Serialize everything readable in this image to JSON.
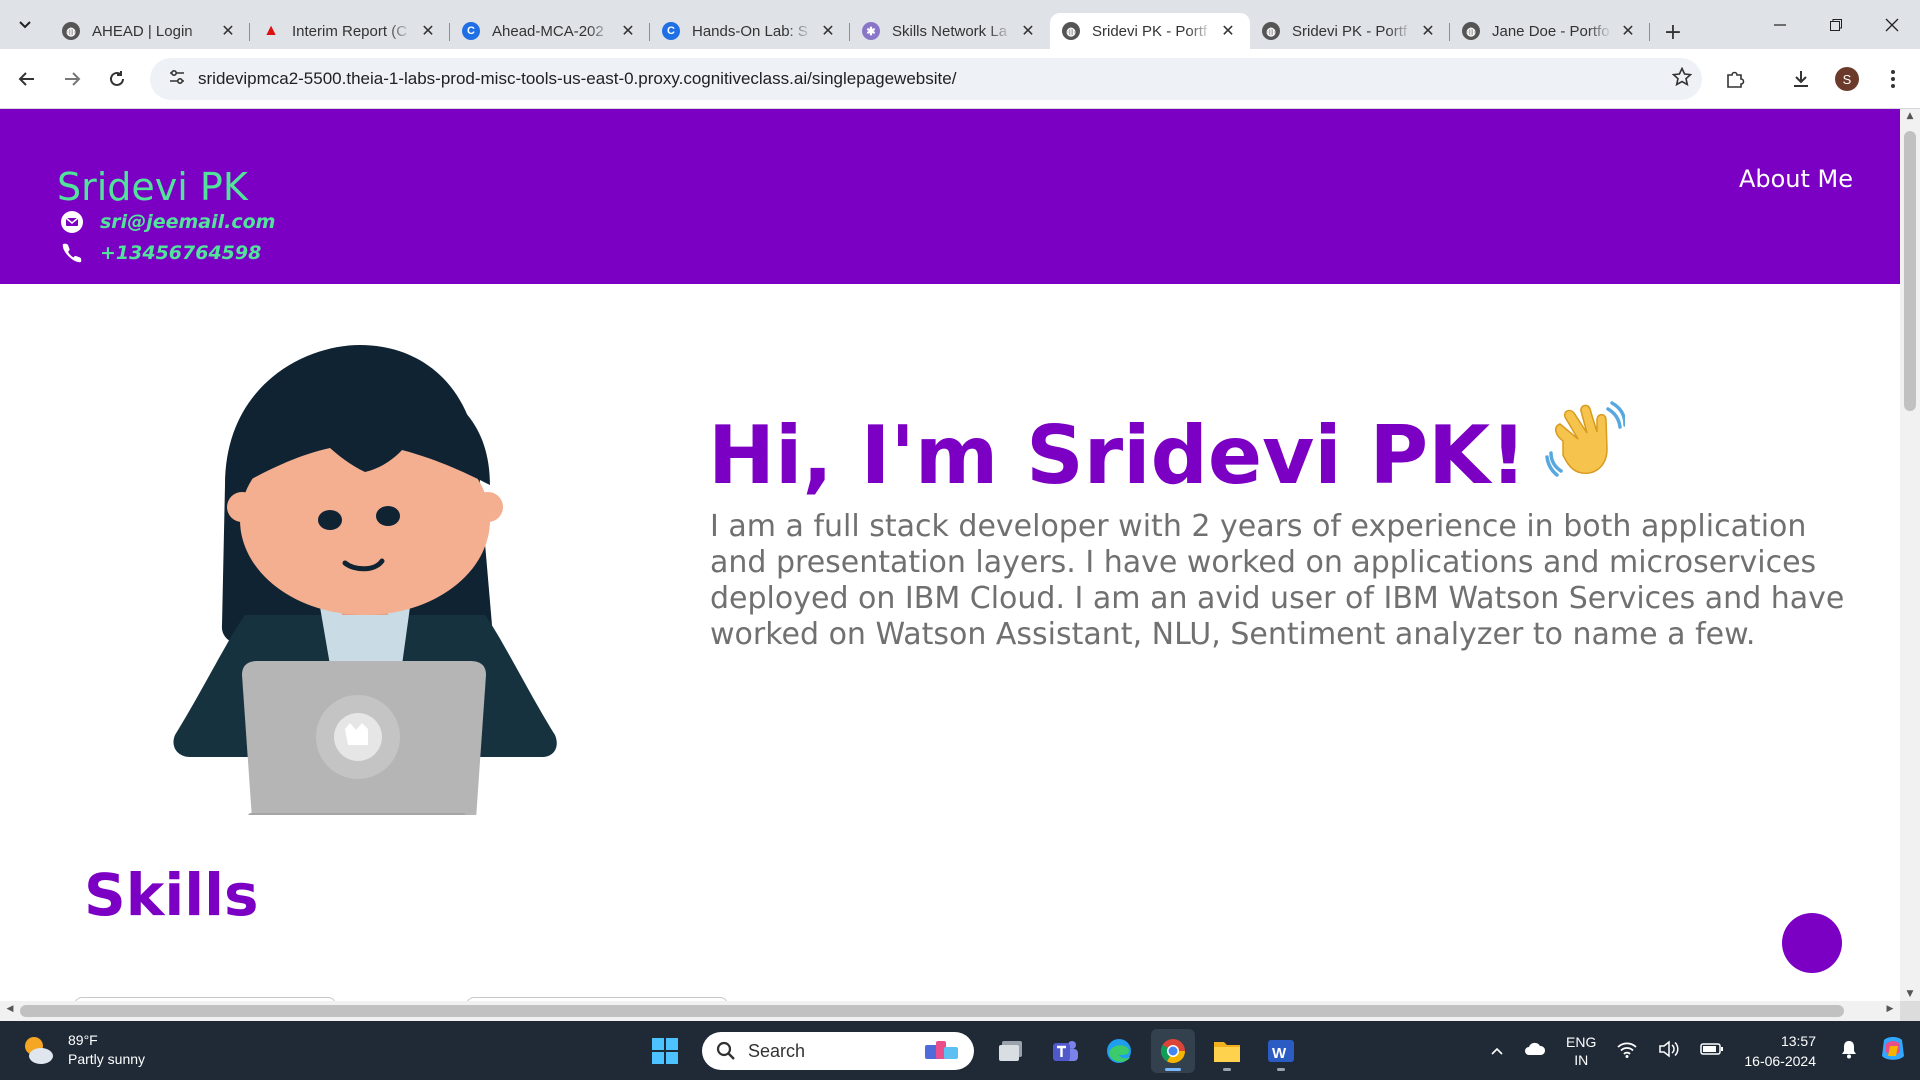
{
  "browser": {
    "tabs": [
      {
        "title": "AHEAD | Login",
        "favicon": "globe-icon"
      },
      {
        "title": "Interim Report (C",
        "favicon": "adobe-icon"
      },
      {
        "title": "Ahead-MCA-202",
        "favicon": "cognitiveclass-icon"
      },
      {
        "title": "Hands-On Lab: S",
        "favicon": "cognitiveclass-icon"
      },
      {
        "title": "Skills Network La",
        "favicon": "skills-network-icon"
      },
      {
        "title": "Sridevi PK - Portf",
        "favicon": "globe-icon",
        "active": true
      },
      {
        "title": "Sridevi PK - Portf",
        "favicon": "globe-icon"
      },
      {
        "title": "Jane Doe - Portfo",
        "favicon": "globe-icon"
      }
    ],
    "url": "sridevipmca2-5500.theia-1-labs-prod-misc-tools-us-east-0.proxy.cognitiveclass.ai/singlepagewebsite/",
    "profile_initial": "S"
  },
  "site": {
    "name": "Sridevi PK",
    "email": "sri@jeemail.com",
    "phone": "+13456764598",
    "nav_about": "About Me",
    "hero_title": "Hi, I'm Sridevi PK!",
    "hero_text": "I am a full stack developer with 2 years of experience in both application and presentation layers. I have worked on applications and microservices deployed on IBM Cloud. I am an avid user of IBM Watson Services and have worked on Watson Assistant, NLU, Sentiment analyzer to name a few.",
    "skills_title": "Skills",
    "colors": {
      "header_bg": "#7b00c4",
      "accent_green": "#52e39a",
      "heading_purple": "#7b00c4",
      "body_text": "#707070"
    }
  },
  "taskbar": {
    "temperature": "89°F",
    "weather": "Partly sunny",
    "search_placeholder": "Search",
    "lang_top": "ENG",
    "lang_bottom": "IN",
    "time": "13:57",
    "date": "16-06-2024"
  }
}
